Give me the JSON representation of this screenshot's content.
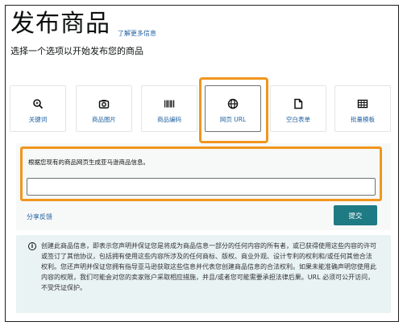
{
  "header": {
    "title": "发布商品",
    "learn_more": "了解更多信息",
    "subtitle": "选择一个选项以开始发布您的商品"
  },
  "options": [
    {
      "label": "关键词",
      "icon": "search-icon"
    },
    {
      "label": "商品图片",
      "icon": "camera-icon"
    },
    {
      "label": "商品编码",
      "icon": "barcode-icon"
    },
    {
      "label": "网页 URL",
      "icon": "globe-icon",
      "selected": true
    },
    {
      "label": "空白表单",
      "icon": "document-icon"
    },
    {
      "label": "批量模板",
      "icon": "spreadsheet-icon"
    }
  ],
  "url_form": {
    "instruction": "根据您现有的商品网页生成亚马逊商品信息。",
    "input_value": "",
    "feedback": "分享反馈",
    "submit": "提交"
  },
  "notice": {
    "text": "创建此商品信息，即表示您声明并保证您是将成为商品信息一部分的任何内容的所有者，或已获得使用这些内容的许可或签订了其他协议，包括拥有使用这些内容所涉及的任何商标、版权、商业外观、设计专利的权利和/或任何其他合法权利。您还声明并保证您拥有指导亚马逊获取这些信息并代表您创建商品信息的合法权利。如果未能准确声明您使用此内容的权限，我们可能会对您的卖家账户采取相应措施，并且/或者您可能需要承担法律后果。URL 必须可公开访问，不受凭证保护。"
  },
  "colors": {
    "accent_link": "#2162a1",
    "highlight": "#f0961e",
    "primary_button": "#1e7a83",
    "notice_bg": "#e9f3f4"
  }
}
